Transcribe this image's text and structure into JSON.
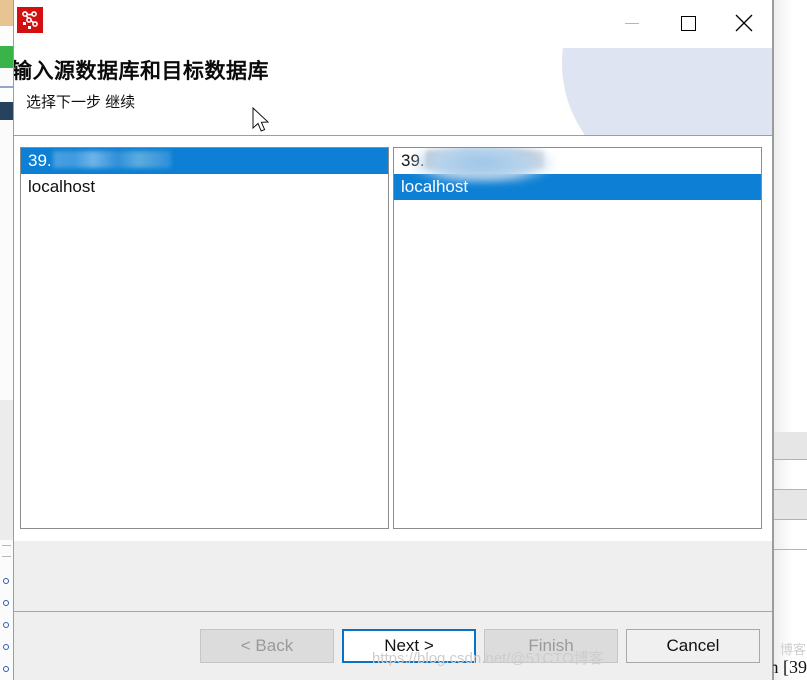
{
  "window": {
    "app_icon": "database-schema-icon",
    "controls": {
      "minimize": "minimize-icon",
      "maximize": "maximize-icon",
      "close": "close-icon"
    }
  },
  "header": {
    "title": "输入源数据库和目标数据库",
    "subtitle": "选择下一步 继续"
  },
  "source_list": {
    "label": "source-database-list",
    "items": [
      {
        "text": "39.",
        "blurred": true,
        "selected": true
      },
      {
        "text": "localhost",
        "blurred": false,
        "selected": false
      }
    ]
  },
  "target_list": {
    "label": "target-database-list",
    "items": [
      {
        "text": "39.",
        "blurred": true,
        "selected": false
      },
      {
        "text": "localhost",
        "blurred": false,
        "selected": true
      }
    ]
  },
  "buttons": {
    "back": "< Back",
    "next": "Next >",
    "finish": "Finish",
    "cancel": "Cancel"
  },
  "watermark": "https://blog.csdn.net/@51CTO博客",
  "background": {
    "right_clipped_text": "n [39"
  },
  "colors": {
    "selection_blue": "#0d7fd4",
    "focus_border": "#0a72c4",
    "icon_red": "#d40f0f",
    "dialog_face": "#efefef",
    "disabled_text": "#9a9a9a"
  }
}
